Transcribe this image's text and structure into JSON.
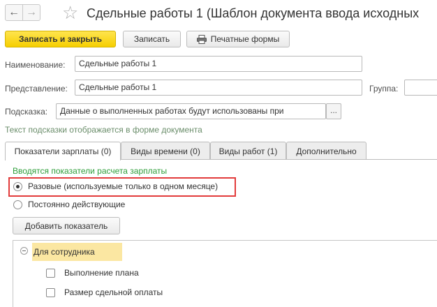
{
  "window": {
    "title": "Сдельные работы 1 (Шаблон документа ввода исходных",
    "back_icon": "arrow-left-icon",
    "forward_icon": "arrow-right-icon",
    "favorite_icon": "star-icon"
  },
  "toolbar": {
    "save_close_label": "Записать и закрыть",
    "save_label": "Записать",
    "print_label": "Печатные формы",
    "print_icon": "printer-icon"
  },
  "form": {
    "name_label": "Наименование:",
    "name_value": "Сдельные работы 1",
    "representation_label": "Представление:",
    "representation_value": "Сдельные работы 1",
    "group_label": "Группа:",
    "group_value": "",
    "hint_label": "Подсказка:",
    "hint_value": "Данные о выполненных работах будут использованы при",
    "hint_button": "...",
    "hint_note": "Текст подсказки отображается в форме документа"
  },
  "tabs": [
    {
      "label": "Показатели зарплаты (0)",
      "active": true
    },
    {
      "label": "Виды времени (0)",
      "active": false
    },
    {
      "label": "Виды работ (1)",
      "active": false
    },
    {
      "label": "Дополнительно",
      "active": false
    }
  ],
  "indicators": {
    "section_title": "Вводятся показатели расчета зарплаты",
    "options": [
      {
        "label": "Разовые (используемые только в одном месяце)",
        "selected": true
      },
      {
        "label": "Постоянно действующие",
        "selected": false
      }
    ],
    "add_button": "Добавить показатель",
    "group_label": "Для сотрудника",
    "items": [
      {
        "label": "Выполнение плана",
        "checked": false
      },
      {
        "label": "Размер сдельной оплаты",
        "checked": false
      }
    ]
  },
  "colors": {
    "primary_button": "#f6cf00",
    "highlight_border": "#e23b3b",
    "section_green": "#2e9e3a",
    "group_row": "#fbe7a2"
  }
}
